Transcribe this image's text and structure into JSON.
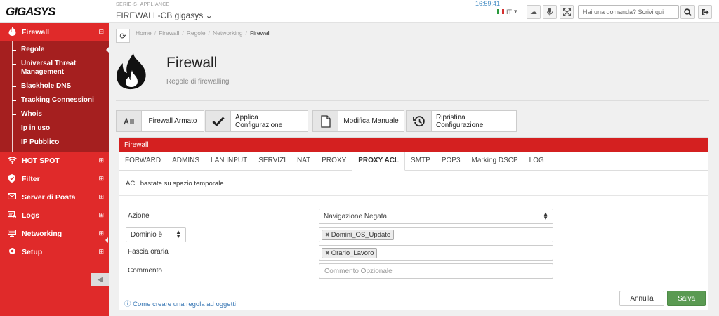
{
  "topbar": {
    "logo": "GIGASYS",
    "appliance_label": "SERIE-S- APPLIANCE",
    "appliance_name": "FIREWALL-CB gigasys ⌄",
    "clock": "16:59:41",
    "language": "IT",
    "ask_placeholder": "Hai una domanda? Scrivi qui",
    "icons": [
      "cloud-icon",
      "microphone-icon",
      "fullscreen-icon",
      "search-icon",
      "logout-icon"
    ]
  },
  "sidebar": {
    "firewall": {
      "label": "Firewall",
      "icon": "flame-icon",
      "toggle": "⊟"
    },
    "firewall_items": [
      "Regole",
      "Universal Threat Management",
      "Blackhole DNS",
      "Tracking Connessioni",
      "Whois",
      "Ip in uso",
      "IP Pubblico"
    ],
    "sections": [
      {
        "label": "HOT SPOT",
        "icon": "wifi-icon",
        "toggle": "⊞"
      },
      {
        "label": "Filter",
        "icon": "shield-icon",
        "toggle": "⊞"
      },
      {
        "label": "Server di Posta",
        "icon": "mail-icon",
        "toggle": "⊞"
      },
      {
        "label": "Logs",
        "icon": "logs-icon",
        "toggle": "⊞"
      },
      {
        "label": "Networking",
        "icon": "network-icon",
        "toggle": "⊞"
      },
      {
        "label": "Setup",
        "icon": "setup-icon",
        "toggle": "⊞"
      }
    ]
  },
  "breadcrumb": {
    "items": [
      "Home",
      "Firewall",
      "Regole",
      "Networking"
    ],
    "current": "Firewall"
  },
  "header": {
    "title": "Firewall",
    "subtitle": "Regole di firewalling"
  },
  "actions": {
    "armed": "Firewall Armato",
    "apply": "Applica Configurazione",
    "manual": "Modifica Manuale",
    "restore": "Ripristina Configurazione"
  },
  "panel": {
    "title": "Firewall",
    "tabs": [
      "FORWARD",
      "ADMINS",
      "LAN INPUT",
      "SERVIZI",
      "NAT",
      "PROXY",
      "PROXY ACL",
      "SMTP",
      "POP3",
      "Marking DSCP",
      "LOG"
    ],
    "active_tab": "PROXY ACL",
    "description": "ACL bastate su spazio temporale",
    "form": {
      "azione_label": "Azione",
      "azione_value": "Navigazione Negata",
      "dominio_select": "Dominio è",
      "dominio_tag": "Domini_OS_Update",
      "fascia_label": "Fascia oraria",
      "fascia_tag": "Orario_Lavoro",
      "commento_label": "Commento",
      "commento_placeholder": "Commento Opzionale"
    },
    "help_link": "Come creare una regola ad oggetti",
    "cancel": "Annulla",
    "save": "Salva"
  },
  "colors": {
    "sidebar_red": "#e02a2a",
    "sidebar_sub": "#a51f1f",
    "panel_header": "#d42020",
    "save_green": "#5a9a52",
    "link_blue": "#3a78b5"
  }
}
